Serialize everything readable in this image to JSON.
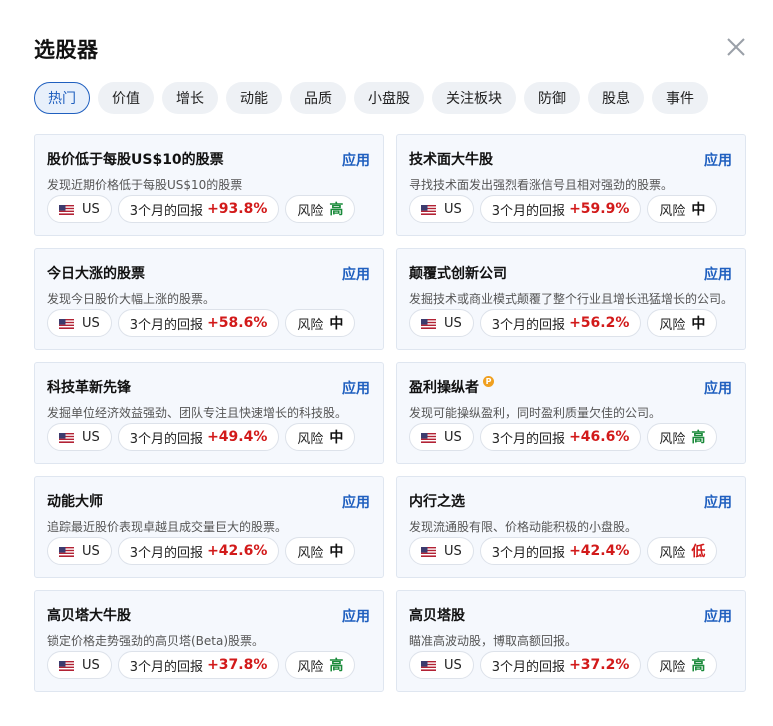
{
  "dialog": {
    "title": "选股器",
    "close_icon": "close-icon"
  },
  "tabs": [
    {
      "label": "热门",
      "active": true
    },
    {
      "label": "价值"
    },
    {
      "label": "增长"
    },
    {
      "label": "动能"
    },
    {
      "label": "品质"
    },
    {
      "label": "小盘股"
    },
    {
      "label": "关注板块"
    },
    {
      "label": "防御"
    },
    {
      "label": "股息"
    },
    {
      "label": "事件"
    }
  ],
  "common": {
    "apply_label": "应用",
    "return_label": "3个月的回报",
    "risk_label": "风险"
  },
  "colors": {
    "accent": "#1f5fbf",
    "positive": "#d21a1a",
    "risk_high": "#1a8a3a",
    "risk_mid": "#111111",
    "risk_low": "#d21a1a"
  },
  "screeners": [
    {
      "title": "股价低于每股US$10的股票",
      "desc": "发现近期价格低于每股US$10的股票",
      "market": "US",
      "return": "+93.8%",
      "risk": "高",
      "risk_level": "high"
    },
    {
      "title": "技术面大牛股",
      "desc": "寻找技术面发出强烈看涨信号且相对强劲的股票。",
      "market": "US",
      "return": "+59.9%",
      "risk": "中",
      "risk_level": "mid"
    },
    {
      "title": "今日大涨的股票",
      "desc": "发现今日股价大幅上涨的股票。",
      "market": "US",
      "return": "+58.6%",
      "risk": "中",
      "risk_level": "mid"
    },
    {
      "title": "颠覆式创新公司",
      "desc": "发掘技术或商业模式颠覆了整个行业且增长迅猛增长的公司。",
      "market": "US",
      "return": "+56.2%",
      "risk": "中",
      "risk_level": "mid"
    },
    {
      "title": "科技革新先锋",
      "desc": "发掘单位经济效益强劲、团队专注且快速增长的科技股。",
      "market": "US",
      "return": "+49.4%",
      "risk": "中",
      "risk_level": "mid"
    },
    {
      "title": "盈利操纵者",
      "desc": "发现可能操纵盈利，同时盈利质量欠佳的公司。",
      "market": "US",
      "return": "+46.6%",
      "risk": "高",
      "risk_level": "high",
      "pro_badge": "P"
    },
    {
      "title": "动能大师",
      "desc": "追踪最近股价表现卓越且成交量巨大的股票。",
      "market": "US",
      "return": "+42.6%",
      "risk": "中",
      "risk_level": "mid"
    },
    {
      "title": "内行之选",
      "desc": "发现流通股有限、价格动能积极的小盘股。",
      "market": "US",
      "return": "+42.4%",
      "risk": "低",
      "risk_level": "low"
    },
    {
      "title": "高贝塔大牛股",
      "desc": "锁定价格走势强劲的高贝塔(Beta)股票。",
      "market": "US",
      "return": "+37.8%",
      "risk": "高",
      "risk_level": "high"
    },
    {
      "title": "高贝塔股",
      "desc": "瞄准高波动股，博取高额回报。",
      "market": "US",
      "return": "+37.2%",
      "risk": "高",
      "risk_level": "high"
    }
  ]
}
